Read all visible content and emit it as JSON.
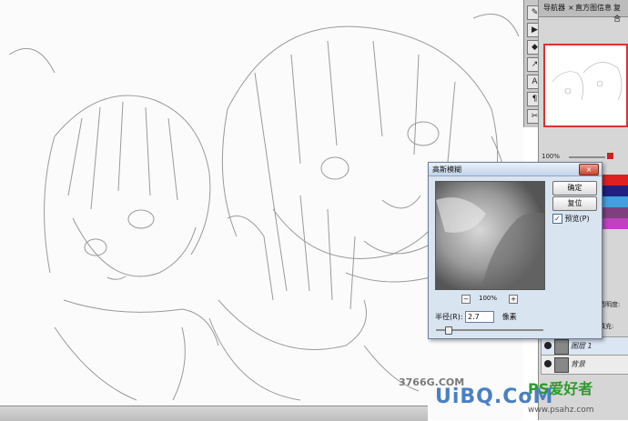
{
  "panel_tabs": [
    "导航器",
    "×",
    "直方图",
    "信息",
    "复合"
  ],
  "tool_icons": [
    "brush-icon",
    "history-icon",
    "stamp-icon",
    "path-icon",
    "text-icon",
    "paragraph-icon",
    "crop-icon"
  ],
  "navigator": {
    "zoom": "100%"
  },
  "layers": [
    {
      "name": "图层 1"
    },
    {
      "name": "背景"
    }
  ],
  "layer_side_labels": [
    "透明度:",
    "填充:"
  ],
  "dialog": {
    "title": "高斯模糊",
    "close_label": "×",
    "ok_label": "确定",
    "reset_label": "复位",
    "preview_label": "预览(P)",
    "preview_checked": "✓",
    "zoom": "100%",
    "zoom_minus": "−",
    "zoom_plus": "+",
    "radius_label": "半径(R):",
    "radius_value": "2.7",
    "radius_unit": "像素",
    "radius_slider_fraction": 0.05
  },
  "watermarks": {
    "site1": "3766G.COM",
    "logo_prefix": "UiBQ.CoM",
    "ps_label": "PS爱好者",
    "url": "www.psahz.com"
  }
}
